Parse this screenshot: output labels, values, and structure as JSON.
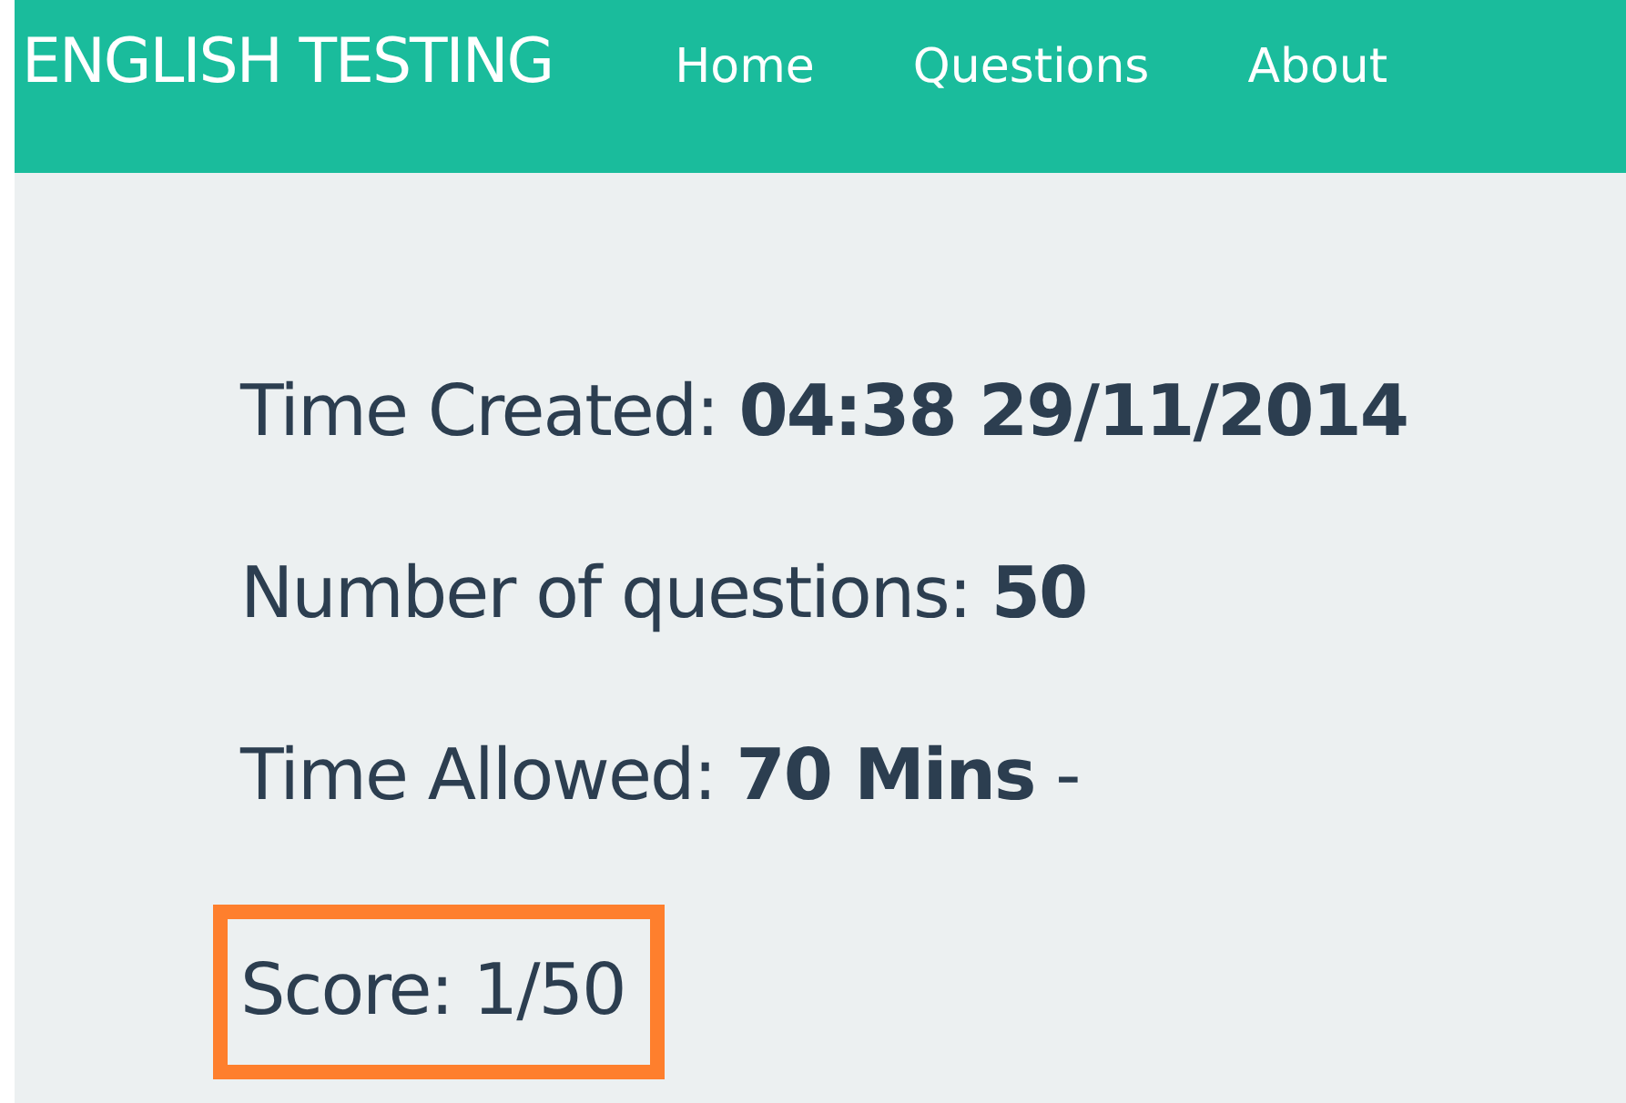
{
  "navbar": {
    "brand": "ENGLISH TESTING",
    "items": [
      {
        "label": "Home"
      },
      {
        "label": "Questions"
      },
      {
        "label": "About"
      }
    ]
  },
  "details": [
    "Time Created: **04:38 29/11/2014**",
    "Number of questions: **50**",
    "Time Allowed: **70 Mins** -"
  ],
  "score": {
    "text": "Score: 1/50",
    "highlighted": true
  }
}
